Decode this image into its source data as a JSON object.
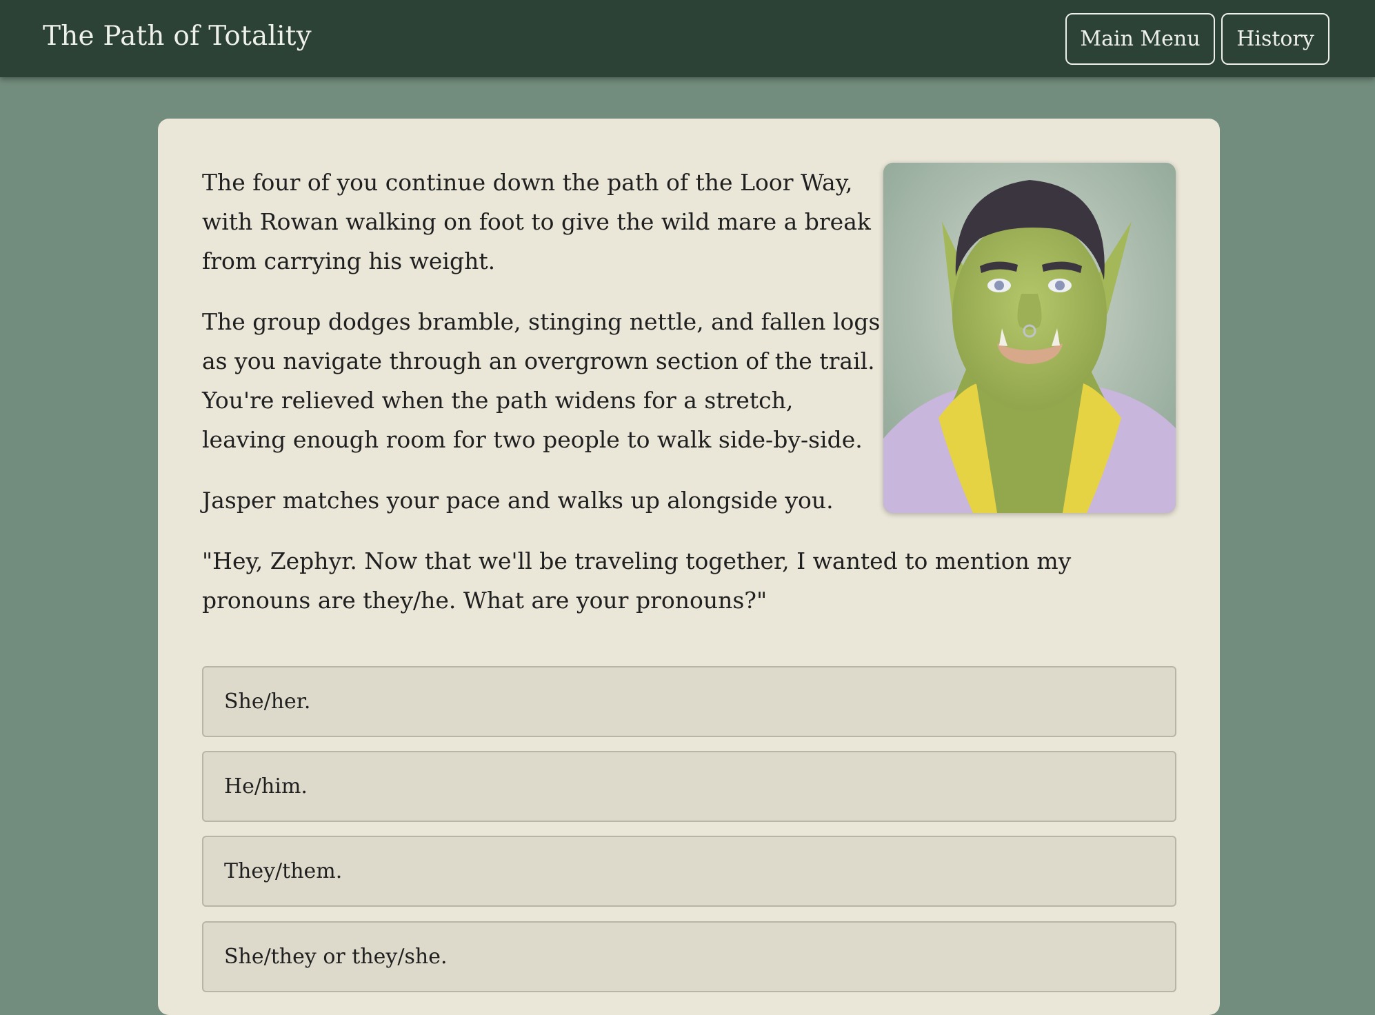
{
  "header": {
    "title": "The Path of Totality",
    "main_menu_label": "Main Menu",
    "history_label": "History"
  },
  "story": {
    "p1_lines": [
      "The four of you continue down the path of the Loor Way,",
      "with Rowan walking on foot to give the wild mare a break",
      "from carrying his weight."
    ],
    "p2_lines": [
      "The group dodges bramble, stinging nettle, and fallen logs",
      "as you navigate through an overgrown section of the trail.",
      "You're relieved when the path widens for a stretch,",
      "leaving enough room for two people to walk side-by-side."
    ],
    "p3": "Jasper matches your pace and walks up alongside you.",
    "p4": "\"Hey, Zephyr. Now that we'll be traveling together, I wanted to mention my pronouns are they/he. What are your pronouns?\""
  },
  "portrait": {
    "subject": "orc-character-portrait"
  },
  "choices": [
    "She/her.",
    "He/him.",
    "They/them.",
    "She/they or they/she."
  ],
  "colors": {
    "background": "#728c7d",
    "topbar": "#2d4237",
    "card": "#eae6d8",
    "choice": "#dedacb"
  }
}
